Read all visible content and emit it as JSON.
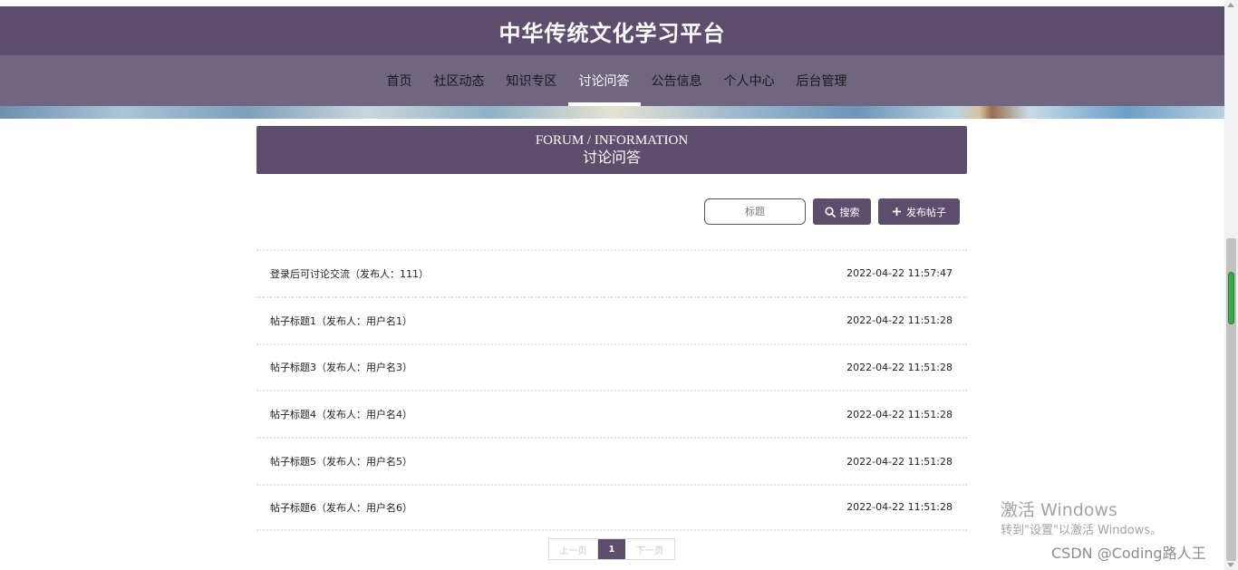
{
  "site": {
    "title": "中华传统文化学习平台"
  },
  "nav": {
    "items": [
      {
        "label": "首页"
      },
      {
        "label": "社区动态"
      },
      {
        "label": "知识专区"
      },
      {
        "label": "讨论问答"
      },
      {
        "label": "公告信息"
      },
      {
        "label": "个人中心"
      },
      {
        "label": "后台管理"
      }
    ],
    "active": "讨论问答"
  },
  "section": {
    "title_en": "FORUM / INFORMATION",
    "title_cn": "讨论问答"
  },
  "toolbar": {
    "search_placeholder": "标题",
    "search_label": "搜索",
    "post_label": "发布帖子"
  },
  "posts": [
    {
      "title": "登录后可讨论交流（发布人：111）",
      "time": "2022-04-22 11:57:47"
    },
    {
      "title": "帖子标题1（发布人：用户名1）",
      "time": "2022-04-22 11:51:28"
    },
    {
      "title": "帖子标题3（发布人：用户名3）",
      "time": "2022-04-22 11:51:28"
    },
    {
      "title": "帖子标题4（发布人：用户名4）",
      "time": "2022-04-22 11:51:28"
    },
    {
      "title": "帖子标题5（发布人：用户名5）",
      "time": "2022-04-22 11:51:28"
    },
    {
      "title": "帖子标题6（发布人：用户名6）",
      "time": "2022-04-22 11:51:28"
    }
  ],
  "pagination": {
    "prev": "上一页",
    "current": "1",
    "next": "下一页"
  },
  "overlay": {
    "activate_title": "激活 Windows",
    "activate_sub": "转到\"设置\"以激活 Windows。",
    "csdn": "CSDN @Coding路人王"
  },
  "colors": {
    "primary": "#5e4e6e",
    "nav": "#706682"
  },
  "icons": {
    "search": "search-icon",
    "add": "plus-icon"
  }
}
